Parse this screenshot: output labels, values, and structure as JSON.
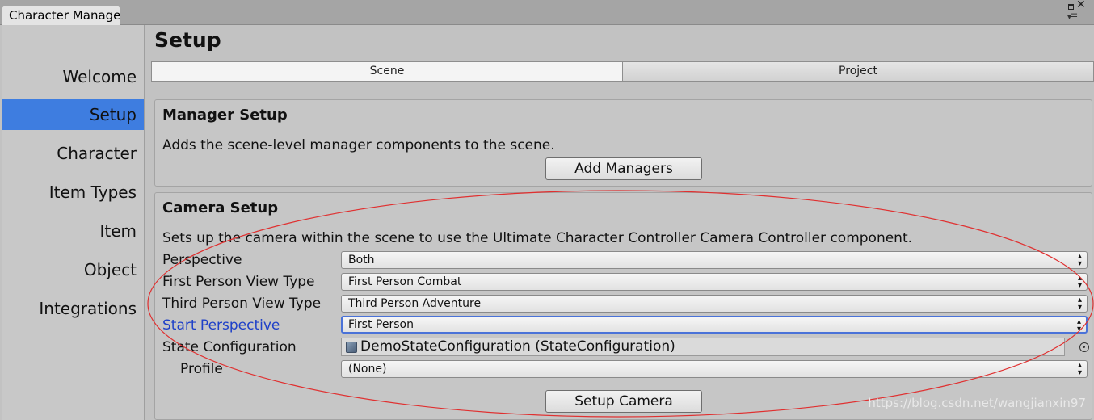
{
  "window": {
    "tab_title": "Character Manager",
    "controls": {
      "maximize": "maximize-icon",
      "close": "close-icon",
      "menu": "menu-icon"
    }
  },
  "sidebar": {
    "items": [
      {
        "label": "Welcome"
      },
      {
        "label": "Setup",
        "active": true
      },
      {
        "label": "Character"
      },
      {
        "label": "Item Types"
      },
      {
        "label": "Item"
      },
      {
        "label": "Object"
      },
      {
        "label": "Integrations"
      }
    ],
    "active_color": "#3e7de0"
  },
  "main": {
    "title": "Setup",
    "toggle": {
      "options": [
        "Scene",
        "Project"
      ],
      "selected": "Scene"
    },
    "manager_setup": {
      "title": "Manager Setup",
      "description": "Adds the scene-level manager components to the scene.",
      "button": "Add Managers"
    },
    "camera_setup": {
      "title": "Camera Setup",
      "description": "Sets up the camera within the scene to use the Ultimate Character Controller Camera Controller component.",
      "fields": {
        "perspective": {
          "label": "Perspective",
          "value": "Both"
        },
        "first_person_view_type": {
          "label": "First Person View Type",
          "value": "First Person Combat"
        },
        "third_person_view_type": {
          "label": "Third Person View Type",
          "value": "Third Person Adventure"
        },
        "start_perspective": {
          "label": "Start Perspective",
          "value": "First Person"
        },
        "state_configuration": {
          "label": "State Configuration",
          "value": "DemoStateConfiguration (StateConfiguration)"
        },
        "profile": {
          "label": "Profile",
          "value": "(None)"
        }
      },
      "button": "Setup Camera"
    }
  },
  "watermark": "https://blog.csdn.net/wangjianxin97",
  "colors": {
    "annotation_ellipse": "#e03030",
    "highlight_label": "#1e40c8",
    "focus_border": "#4a72d8"
  }
}
